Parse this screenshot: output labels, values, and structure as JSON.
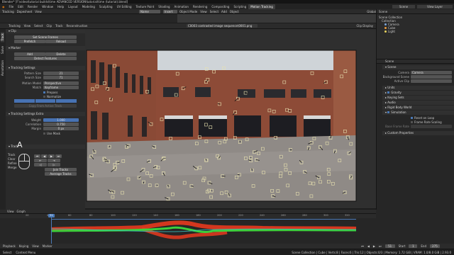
{
  "window": {
    "title": "Blender* [F:\\video\\tutorial builds\\time ADVANCED VERSION\\tutorial\\time (tutorial).blend]"
  },
  "menu": {
    "items": [
      "File",
      "Edit",
      "Render",
      "Window",
      "Help"
    ],
    "workspaces": [
      "Layout",
      "Modeling",
      "Sculpting",
      "UV Editing",
      "Texture Paint",
      "Shading",
      "Animation",
      "Rendering",
      "Compositing",
      "Scripting",
      "Motion Tracking"
    ],
    "active_workspace": "Motion Tracking",
    "scene": "Scene",
    "view_layer": "View Layer"
  },
  "clip_header": {
    "mode": "Tracking",
    "menus": [
      "View",
      "Select",
      "Clip",
      "Track",
      "Reconstruction"
    ],
    "clip_path": "C0003 contrasted image sequence\\0001.png",
    "display": "Clip Display"
  },
  "toolbar_header": {
    "mode": "Tracking",
    "editor": "Dopesheet",
    "view": "View",
    "name_field": "Name",
    "frame_field": "Insert"
  },
  "view3d_header": {
    "mode": "Object Mode",
    "menus": [
      "View",
      "Select",
      "Add",
      "Object"
    ],
    "orientation": "Global"
  },
  "left_panel": {
    "tabs": [
      "Track",
      "Solve",
      "Annotation"
    ],
    "clip": {
      "title": "Clip",
      "set_scene_frames": "Set Scene Frames",
      "prefetch": "Prefetch",
      "reload": "Reload"
    },
    "marker": {
      "title": "Marker",
      "add": "Add",
      "delete": "Delete",
      "detect": "Detect Features"
    },
    "tracking_settings": {
      "title": "Tracking Settings",
      "pattern_size_label": "Pattern Size",
      "pattern_size": "21",
      "search_size_label": "Search Size",
      "search_size": "71",
      "motion_model_label": "Motion Model",
      "motion_model": "Perspective",
      "match_label": "Match",
      "match": "Keyframe",
      "prepass": "Prepass",
      "normalize": "Normalize",
      "copy_from_active": "Copy From Active Track"
    },
    "tracking_extra": {
      "title": "Tracking Settings Extra",
      "weight_label": "Weight",
      "weight": "1.000",
      "correlation_label": "Correlation",
      "correlation": "0.750",
      "margin_label": "Margin",
      "margin": "0 px",
      "use_mask": "Use Mask"
    },
    "track": {
      "title": "Track",
      "key_label": "A",
      "labels": [
        "Track",
        "Clear",
        "Refine",
        "Merge"
      ],
      "join_tracks": "Join Tracks",
      "average_tracks": "Average Tracks"
    }
  },
  "right_panel": {
    "outliner_title": "Scene",
    "outliner_items": [
      "Scene Collection",
      "Collection",
      "Camera",
      "Cube",
      "Light"
    ],
    "properties": {
      "scene_title": "Scene",
      "scene_section": "Scene",
      "camera_label": "Camera",
      "camera": "Camera",
      "background_scene_label": "Background Scene",
      "active_clip_label": "Active Clip",
      "sections": [
        "Units",
        "Gravity",
        "Keying Sets",
        "Audio",
        "Rigid Body World",
        "Simulation",
        "Custom Properties"
      ],
      "rigid_items": [
        "Reset on Loop",
        "Frame Rate Scaling"
      ],
      "dynamics_label": "Base Frame Rate"
    }
  },
  "timeline": {
    "header_menus": [
      "View",
      "Graph"
    ],
    "ticks": [
      "20",
      "40",
      "60",
      "80",
      "100",
      "120",
      "140",
      "160",
      "180",
      "200",
      "220",
      "240",
      "260",
      "280",
      "300",
      "320"
    ],
    "current_frame": "51"
  },
  "playback": {
    "menus": [
      "Playback",
      "Keying",
      "View",
      "Marker"
    ],
    "start_label": "Start",
    "start": "1",
    "end_label": "End",
    "end": "275",
    "frame": "51"
  },
  "status_bar": {
    "left": "Select",
    "middle": "Context Menu",
    "right": "Scene Collection | Cube | Verts:8 | Faces:6 | Tris:12 | Objects:0/3 | Memory: 1.72 GiB | VRAM: 1.0/8.0 GiB | 2.93.0"
  },
  "colors": {
    "accent": "#4772b3",
    "track_marker": "#e8e2b0",
    "graph_red": "#e83a1e",
    "graph_green": "#3cd03c",
    "playhead": "#4a7ab8"
  }
}
